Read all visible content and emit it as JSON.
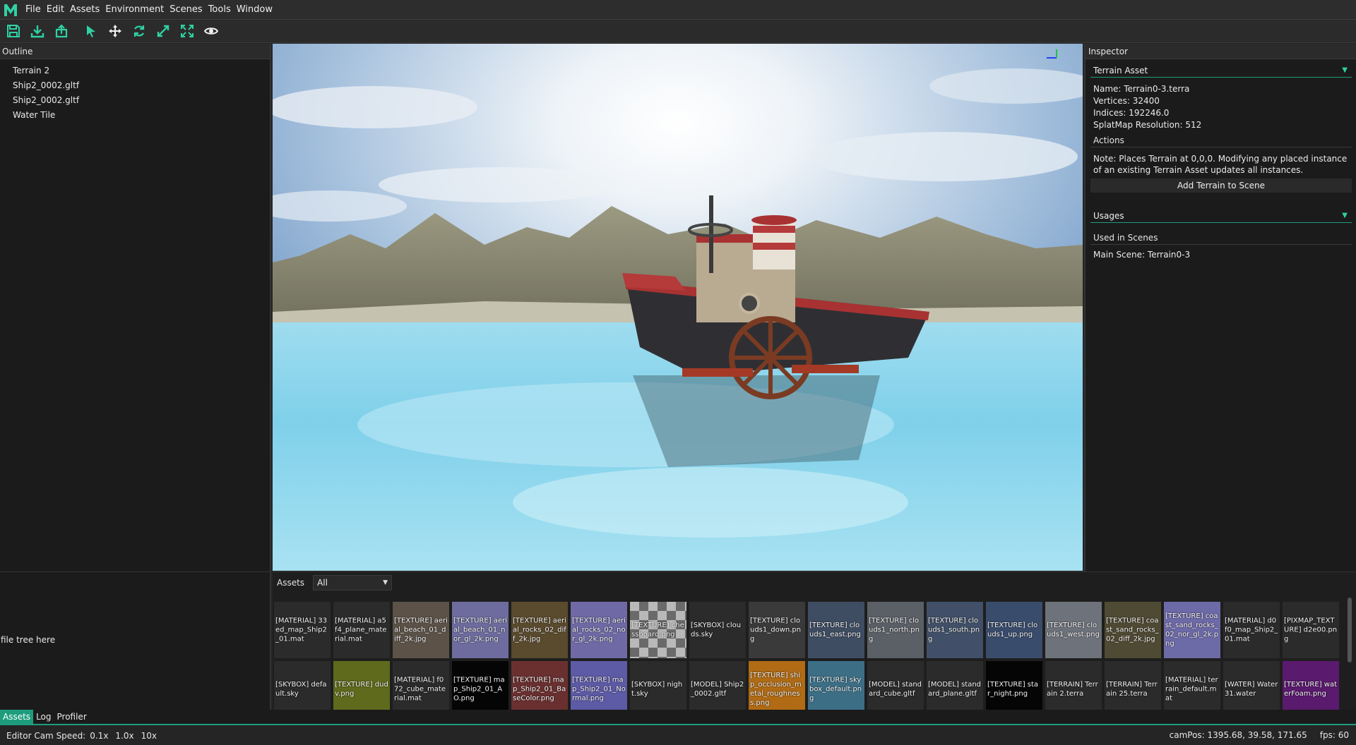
{
  "menu": {
    "items": [
      "File",
      "Edit",
      "Assets",
      "Environment",
      "Scenes",
      "Tools",
      "Window"
    ]
  },
  "toolbar": {
    "tools": [
      "save-icon",
      "import-icon",
      "export-icon",
      "select-icon",
      "translate-icon",
      "rotate-icon",
      "scale-icon",
      "fullscreen-icon",
      "visibility-icon"
    ],
    "accent": "#2fd1a4"
  },
  "outline": {
    "title": "Outline",
    "items": [
      "Terrain 2",
      "Ship2_0002.gltf",
      "Ship2_0002.gltf",
      "Water Tile"
    ]
  },
  "inspector": {
    "title": "Inspector",
    "terrain_asset": {
      "header": "Terrain Asset",
      "name": "Name: Terrain0-3.terra",
      "vertices": "Vertices: 32400",
      "indices": "Indices: 192246.0",
      "splatmap": "SplatMap Resolution: 512",
      "actions": "Actions",
      "note": "Note: Places Terrain at 0,0,0. Modifying any placed instance of an existing Terrain Asset updates all instances.",
      "add_button": "Add Terrain to Scene"
    },
    "usages": {
      "header": "Usages",
      "used_in": "Used in Scenes",
      "entry": "Main Scene: Terrain0-3"
    }
  },
  "file_tree": {
    "placeholder": "file tree here"
  },
  "assets": {
    "title": "Assets",
    "filter": "All",
    "items": [
      {
        "label": "[MATERIAL] 33ed_map_Ship2_01.mat",
        "color": "#2b2b2b"
      },
      {
        "label": "[MATERIAL] a5f4_plane_material.mat",
        "color": "#2b2b2b"
      },
      {
        "label": "[TEXTURE] aerial_beach_01_diff_2k.jpg",
        "color": "#5c5248"
      },
      {
        "label": "[TEXTURE] aerial_beach_01_nor_gl_2k.png",
        "color": "#6e6c9e"
      },
      {
        "label": "[TEXTURE] aerial_rocks_02_diff_2k.jpg",
        "color": "#5a4a2e"
      },
      {
        "label": "[TEXTURE] aerial_rocks_02_nor_gl_2k.png",
        "color": "#6f6aa5"
      },
      {
        "label": "[TEXTURE] chessboard.png",
        "color": "checker"
      },
      {
        "label": "[SKYBOX] clouds.sky",
        "color": "#2b2b2b"
      },
      {
        "label": "[TEXTURE] clouds1_down.png",
        "color": "#3a3a3a"
      },
      {
        "label": "[TEXTURE] clouds1_east.png",
        "color": "#3f4d62"
      },
      {
        "label": "[TEXTURE] clouds1_north.png",
        "color": "#5b5f66"
      },
      {
        "label": "[TEXTURE] clouds1_south.png",
        "color": "#415068"
      },
      {
        "label": "[TEXTURE] clouds1_up.png",
        "color": "#3a4c6c"
      },
      {
        "label": "[TEXTURE] clouds1_west.png",
        "color": "#6e727a"
      },
      {
        "label": "[TEXTURE] coast_sand_rocks_02_diff_2k.jpg",
        "color": "#4f4a33"
      },
      {
        "label": "[TEXTURE] coast_sand_rocks_02_nor_gl_2k.png",
        "color": "#6d6aa8"
      },
      {
        "label": "[MATERIAL] d0f0_map_Ship2_01.mat",
        "color": "#2b2b2b"
      },
      {
        "label": "[PIXMAP_TEXTURE] d2e00.png",
        "color": "#2b2b2b"
      },
      {
        "label": "[SKYBOX] default.sky",
        "color": "#2b2b2b"
      },
      {
        "label": "[TEXTURE] dudv.png",
        "color": "#5f6a1c"
      },
      {
        "label": "[MATERIAL] f072_cube_material.mat",
        "color": "#2b2b2b"
      },
      {
        "label": "[TEXTURE] map_Ship2_01_AO.png",
        "color": "#050505"
      },
      {
        "label": "[TEXTURE] map_Ship2_01_BaseColor.png",
        "color": "#6a3030"
      },
      {
        "label": "[TEXTURE] map_Ship2_01_Normal.png",
        "color": "#5d5aa6"
      },
      {
        "label": "[SKYBOX] night.sky",
        "color": "#2b2b2b"
      },
      {
        "label": "[MODEL] Ship2_0002.gltf",
        "color": "#2b2b2b"
      },
      {
        "label": "[TEXTURE] ship_occlusion_metal_roughness.png",
        "color": "#b06b14"
      },
      {
        "label": "[TEXTURE] skybox_default.png",
        "color": "#3c6f86"
      },
      {
        "label": "[MODEL] standard_cube.gltf",
        "color": "#2b2b2b"
      },
      {
        "label": "[MODEL] standard_plane.gltf",
        "color": "#2b2b2b"
      },
      {
        "label": "[TEXTURE] star_night.png",
        "color": "#050505"
      },
      {
        "label": "[TERRAIN] Terrain 2.terra",
        "color": "#2b2b2b"
      },
      {
        "label": "[TERRAIN] Terrain 25.terra",
        "color": "#2b2b2b"
      },
      {
        "label": "[MATERIAL] terrain_default.mat",
        "color": "#2b2b2b"
      },
      {
        "label": "[WATER] Water 31.water",
        "color": "#2b2b2b"
      },
      {
        "label": "[TEXTURE] waterFoam.png",
        "color": "#5a1a6e"
      }
    ]
  },
  "bottom_tabs": [
    "Assets",
    "Log",
    "Profiler"
  ],
  "status": {
    "cam_speed_label": "Editor Cam Speed:",
    "speeds": [
      "0.1x",
      "1.0x",
      "10x"
    ],
    "campos": "camPos: 1395.68, 39.58, 171.65",
    "fps": "fps: 60"
  }
}
